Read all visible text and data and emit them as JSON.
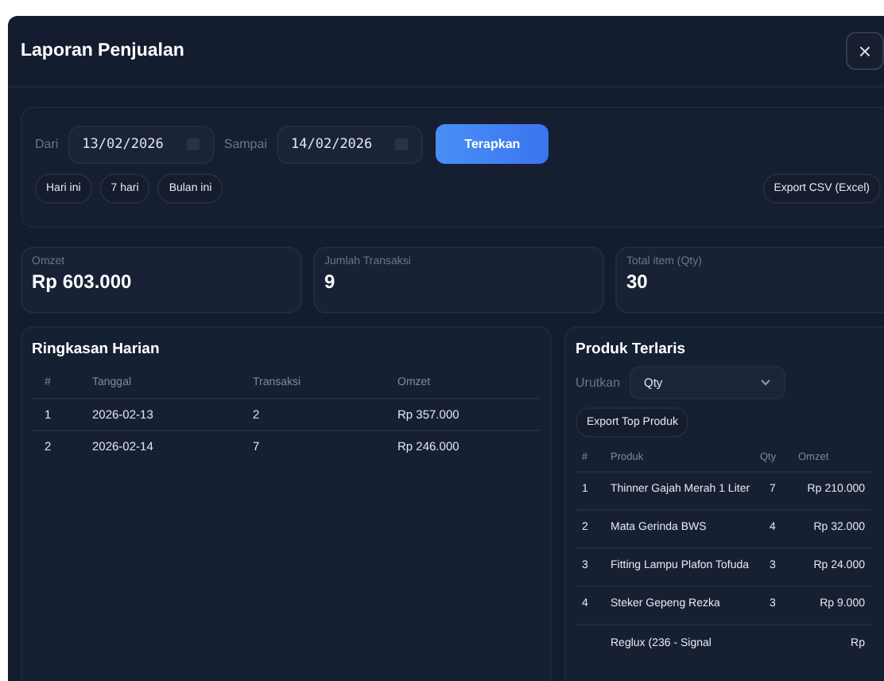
{
  "window": {
    "title": "Laporan Penjualan",
    "close": "×"
  },
  "filter": {
    "from_label": "Dari",
    "from": "13/02/2026",
    "to_label": "Sampai",
    "to": "14/02/2026",
    "apply": "Terapkan",
    "presets": [
      "Hari ini",
      "7 hari",
      "Bulan ini"
    ],
    "export": "Export CSV (Excel)"
  },
  "stats": [
    {
      "label": "Omzet",
      "value": "Rp 603.000"
    },
    {
      "label": "Jumlah Transaksi",
      "value": "9"
    },
    {
      "label": "Total item (Qty)",
      "value": "30"
    }
  ],
  "daily": {
    "title": "Ringkasan Harian",
    "columns": [
      "#",
      "Tanggal",
      "Transaksi",
      "Omzet"
    ],
    "rows": [
      [
        "1",
        "2026-02-13",
        "2",
        "Rp 357.000"
      ],
      [
        "2",
        "2026-02-14",
        "7",
        "Rp 246.000"
      ]
    ]
  },
  "top": {
    "title": "Produk Terlaris",
    "sort_label": "Urutkan",
    "sort_value": "Qty",
    "export": "Export Top Produk",
    "columns": [
      "#",
      "Produk",
      "Qty",
      "Omzet"
    ],
    "rows": [
      [
        "1",
        "Thinner Gajah Merah 1 Liter",
        "7",
        "Rp 210.000"
      ],
      [
        "2",
        "Mata Gerinda BWS",
        "4",
        "Rp 32.000"
      ],
      [
        "3",
        "Fitting Lampu Plafon Tofuda",
        "3",
        "Rp 24.000"
      ],
      [
        "4",
        "Steker Gepeng Rezka",
        "3",
        "Rp 9.000"
      ],
      [
        "",
        "Reglux (236 - Signal",
        "",
        "Rp"
      ]
    ]
  }
}
